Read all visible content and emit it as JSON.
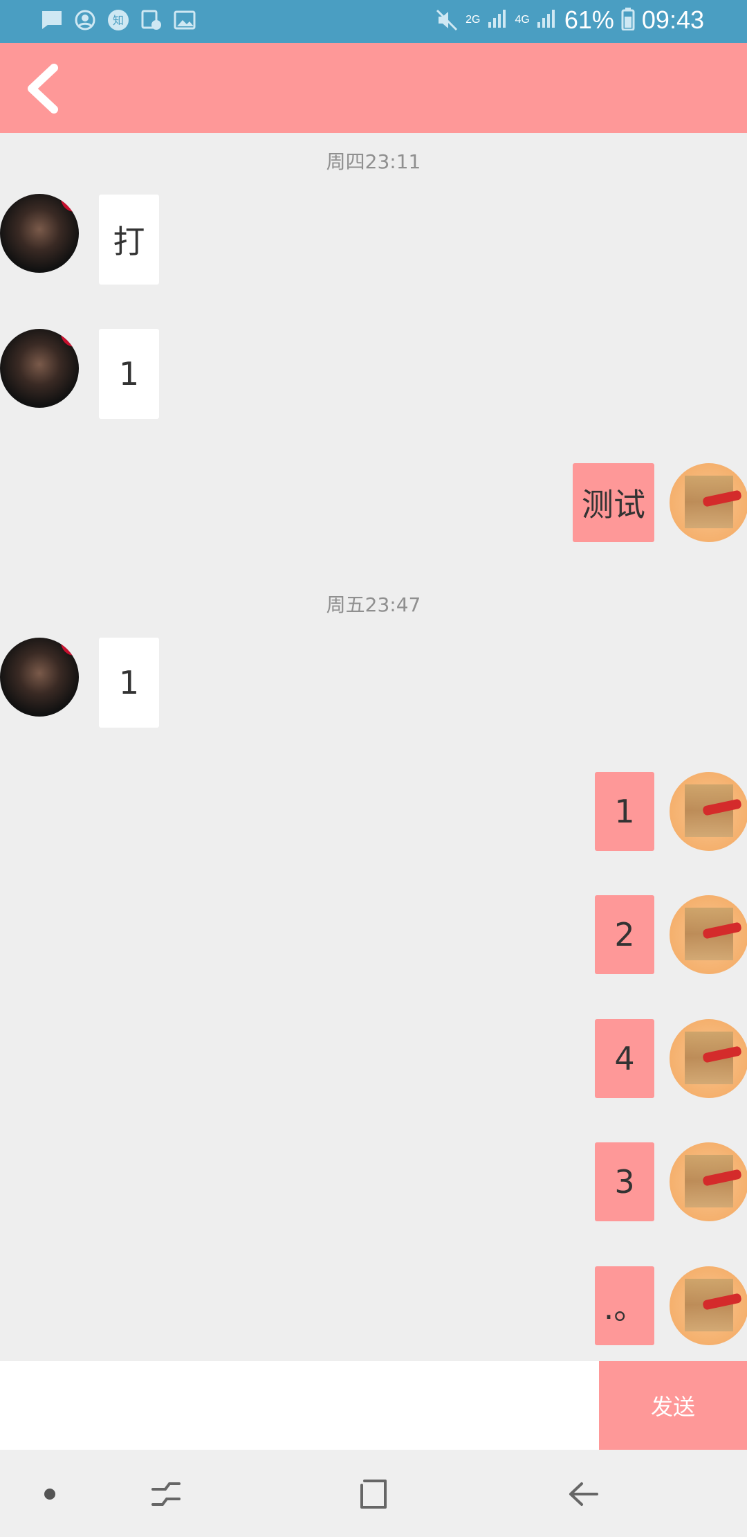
{
  "status_bar": {
    "icons": [
      "message-icon",
      "account-icon",
      "zhihu-icon",
      "calendar-clock-icon",
      "image-icon",
      "mute-icon",
      "signal-2g-icon",
      "signal-4g-icon",
      "battery-icon"
    ],
    "net_2g": "2G",
    "net_4g": "4G",
    "battery": "61%",
    "time": "09:43"
  },
  "header": {
    "back_icon": "chevron-left-icon"
  },
  "chat": {
    "groups": [
      {
        "timestamp": "周四23:11"
      },
      {
        "timestamp": "周五23:47"
      }
    ],
    "messages": [
      {
        "side": "left",
        "text": "打"
      },
      {
        "side": "left",
        "text": "1"
      },
      {
        "side": "right",
        "text": "测试"
      },
      {
        "side": "left",
        "text": "1"
      },
      {
        "side": "right",
        "text": "1"
      },
      {
        "side": "right",
        "text": "2"
      },
      {
        "side": "right",
        "text": "4"
      },
      {
        "side": "right",
        "text": "3"
      },
      {
        "side": "right",
        "text": ".。"
      }
    ]
  },
  "composer": {
    "input_value": "",
    "send_label": "发送"
  },
  "nav_bar": {
    "icons": [
      "dot-icon",
      "recent-apps-icon",
      "home-icon",
      "back-arrow-icon"
    ]
  },
  "colors": {
    "status_bar": "#4a9ec2",
    "accent": "#fe9898",
    "background": "#eeeeee"
  }
}
